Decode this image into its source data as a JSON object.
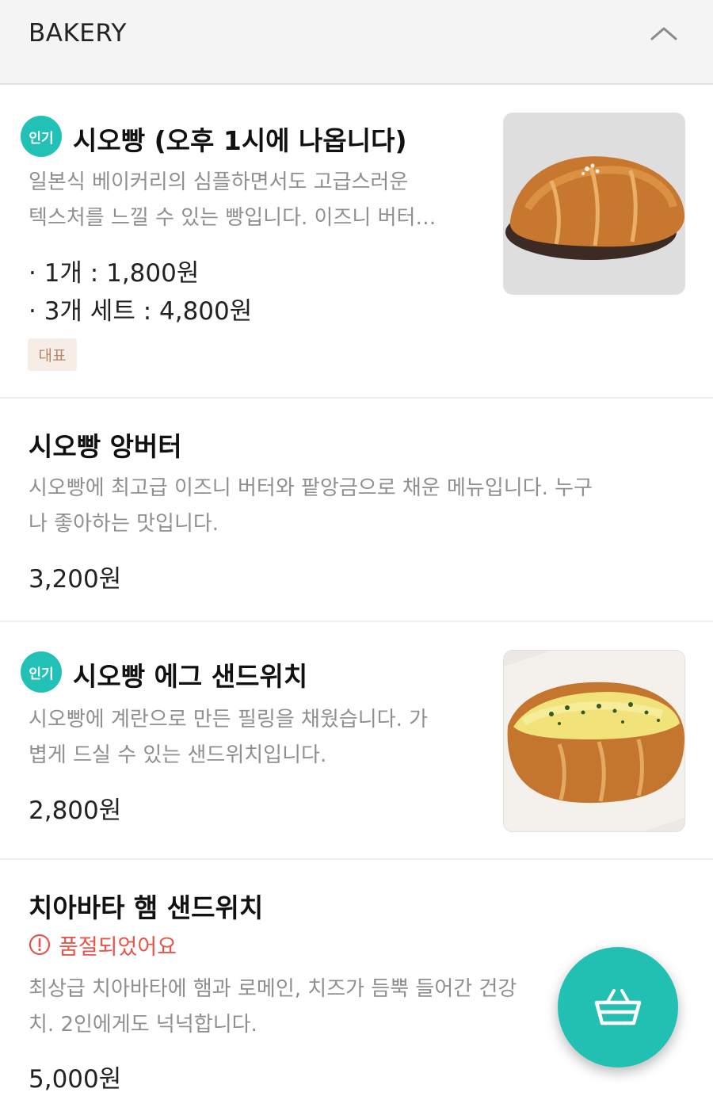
{
  "section": {
    "title": "BAKERY",
    "collapse_icon": "chevron-up-icon"
  },
  "badges": {
    "popular": "인기",
    "representative": "대표"
  },
  "items": [
    {
      "name": "시오빵 (오후 1시에 나옵니다)",
      "badge": "인기",
      "description_lines": [
        "일본식 베이커리의 심플하면서도 고급스러운",
        "텍스처를 느낄 수 있는 빵입니다. 이즈니 버터…"
      ],
      "prices": [
        "· 1개 : 1,800원",
        "· 3개 세트 : 4,800원"
      ],
      "tag": "대표"
    },
    {
      "name": "시오빵 앙버터",
      "description_lines": [
        "시오빵에 최고급 이즈니 버터와 팥앙금으로 채운 메뉴입니다. 누구",
        "나 좋아하는 맛입니다."
      ],
      "price": "3,200원"
    },
    {
      "name": "시오빵 에그 샌드위치",
      "badge": "인기",
      "description_lines": [
        "시오빵에 계란으로 만든 필링을 채웠습니다. 가",
        "볍게 드실 수 있는 샌드위치입니다."
      ],
      "price": "2,800원"
    },
    {
      "name": "치아바타 햄 샌드위치",
      "status": "품절되었어요",
      "description_lines": [
        "최상급 치아바타에 햄과 로메인, 치즈가 듬뿍 들어간 건강",
        "치. 2인에게도 넉넉합니다."
      ],
      "price": "5,000원"
    }
  ],
  "colors": {
    "accent": "#22bfb3",
    "soldout": "#e8544a",
    "tag_bg": "#f5ede6",
    "tag_text": "#b5876a"
  },
  "fab": {
    "icon": "shopping-basket-icon"
  }
}
